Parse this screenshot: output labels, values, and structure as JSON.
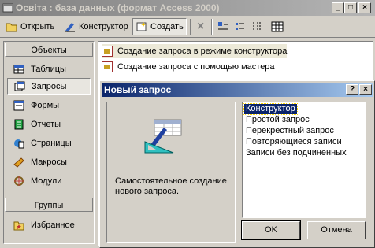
{
  "window": {
    "title": "Освіта : база данных (формат Access 2000)",
    "buttons": {
      "minimize": "_",
      "maximize": "□",
      "close": "×"
    }
  },
  "toolbar": {
    "open_label": "Открыть",
    "design_label": "Конструктор",
    "create_label": "Создать",
    "delete_icon": "×"
  },
  "objects": {
    "header": "Объекты",
    "items": [
      {
        "label": "Таблицы",
        "icon": "table-icon"
      },
      {
        "label": "Запросы",
        "icon": "query-icon",
        "selected": true
      },
      {
        "label": "Формы",
        "icon": "form-icon"
      },
      {
        "label": "Отчеты",
        "icon": "report-icon"
      },
      {
        "label": "Страницы",
        "icon": "page-icon"
      },
      {
        "label": "Макросы",
        "icon": "macro-icon"
      },
      {
        "label": "Модули",
        "icon": "module-icon"
      }
    ],
    "groups_header": "Группы",
    "favorites_label": "Избранное"
  },
  "list": {
    "items": [
      "Создание запроса в режиме конструктора",
      "Создание запроса с помощью мастера"
    ]
  },
  "dialog": {
    "title": "Новый запрос",
    "help_button": "?",
    "close_button": "×",
    "description": "Самостоятельное создание нового запроса.",
    "options": [
      "Конструктор",
      "Простой запрос",
      "Перекрестный запрос",
      "Повторяющиеся записи",
      "Записи без подчиненных"
    ],
    "selected_index": 0,
    "ok_label": "OK",
    "cancel_label": "Отмена"
  },
  "colors": {
    "dialog_title": "#0a246a",
    "selection": "#0a246a",
    "inactive_title": "#808080"
  }
}
